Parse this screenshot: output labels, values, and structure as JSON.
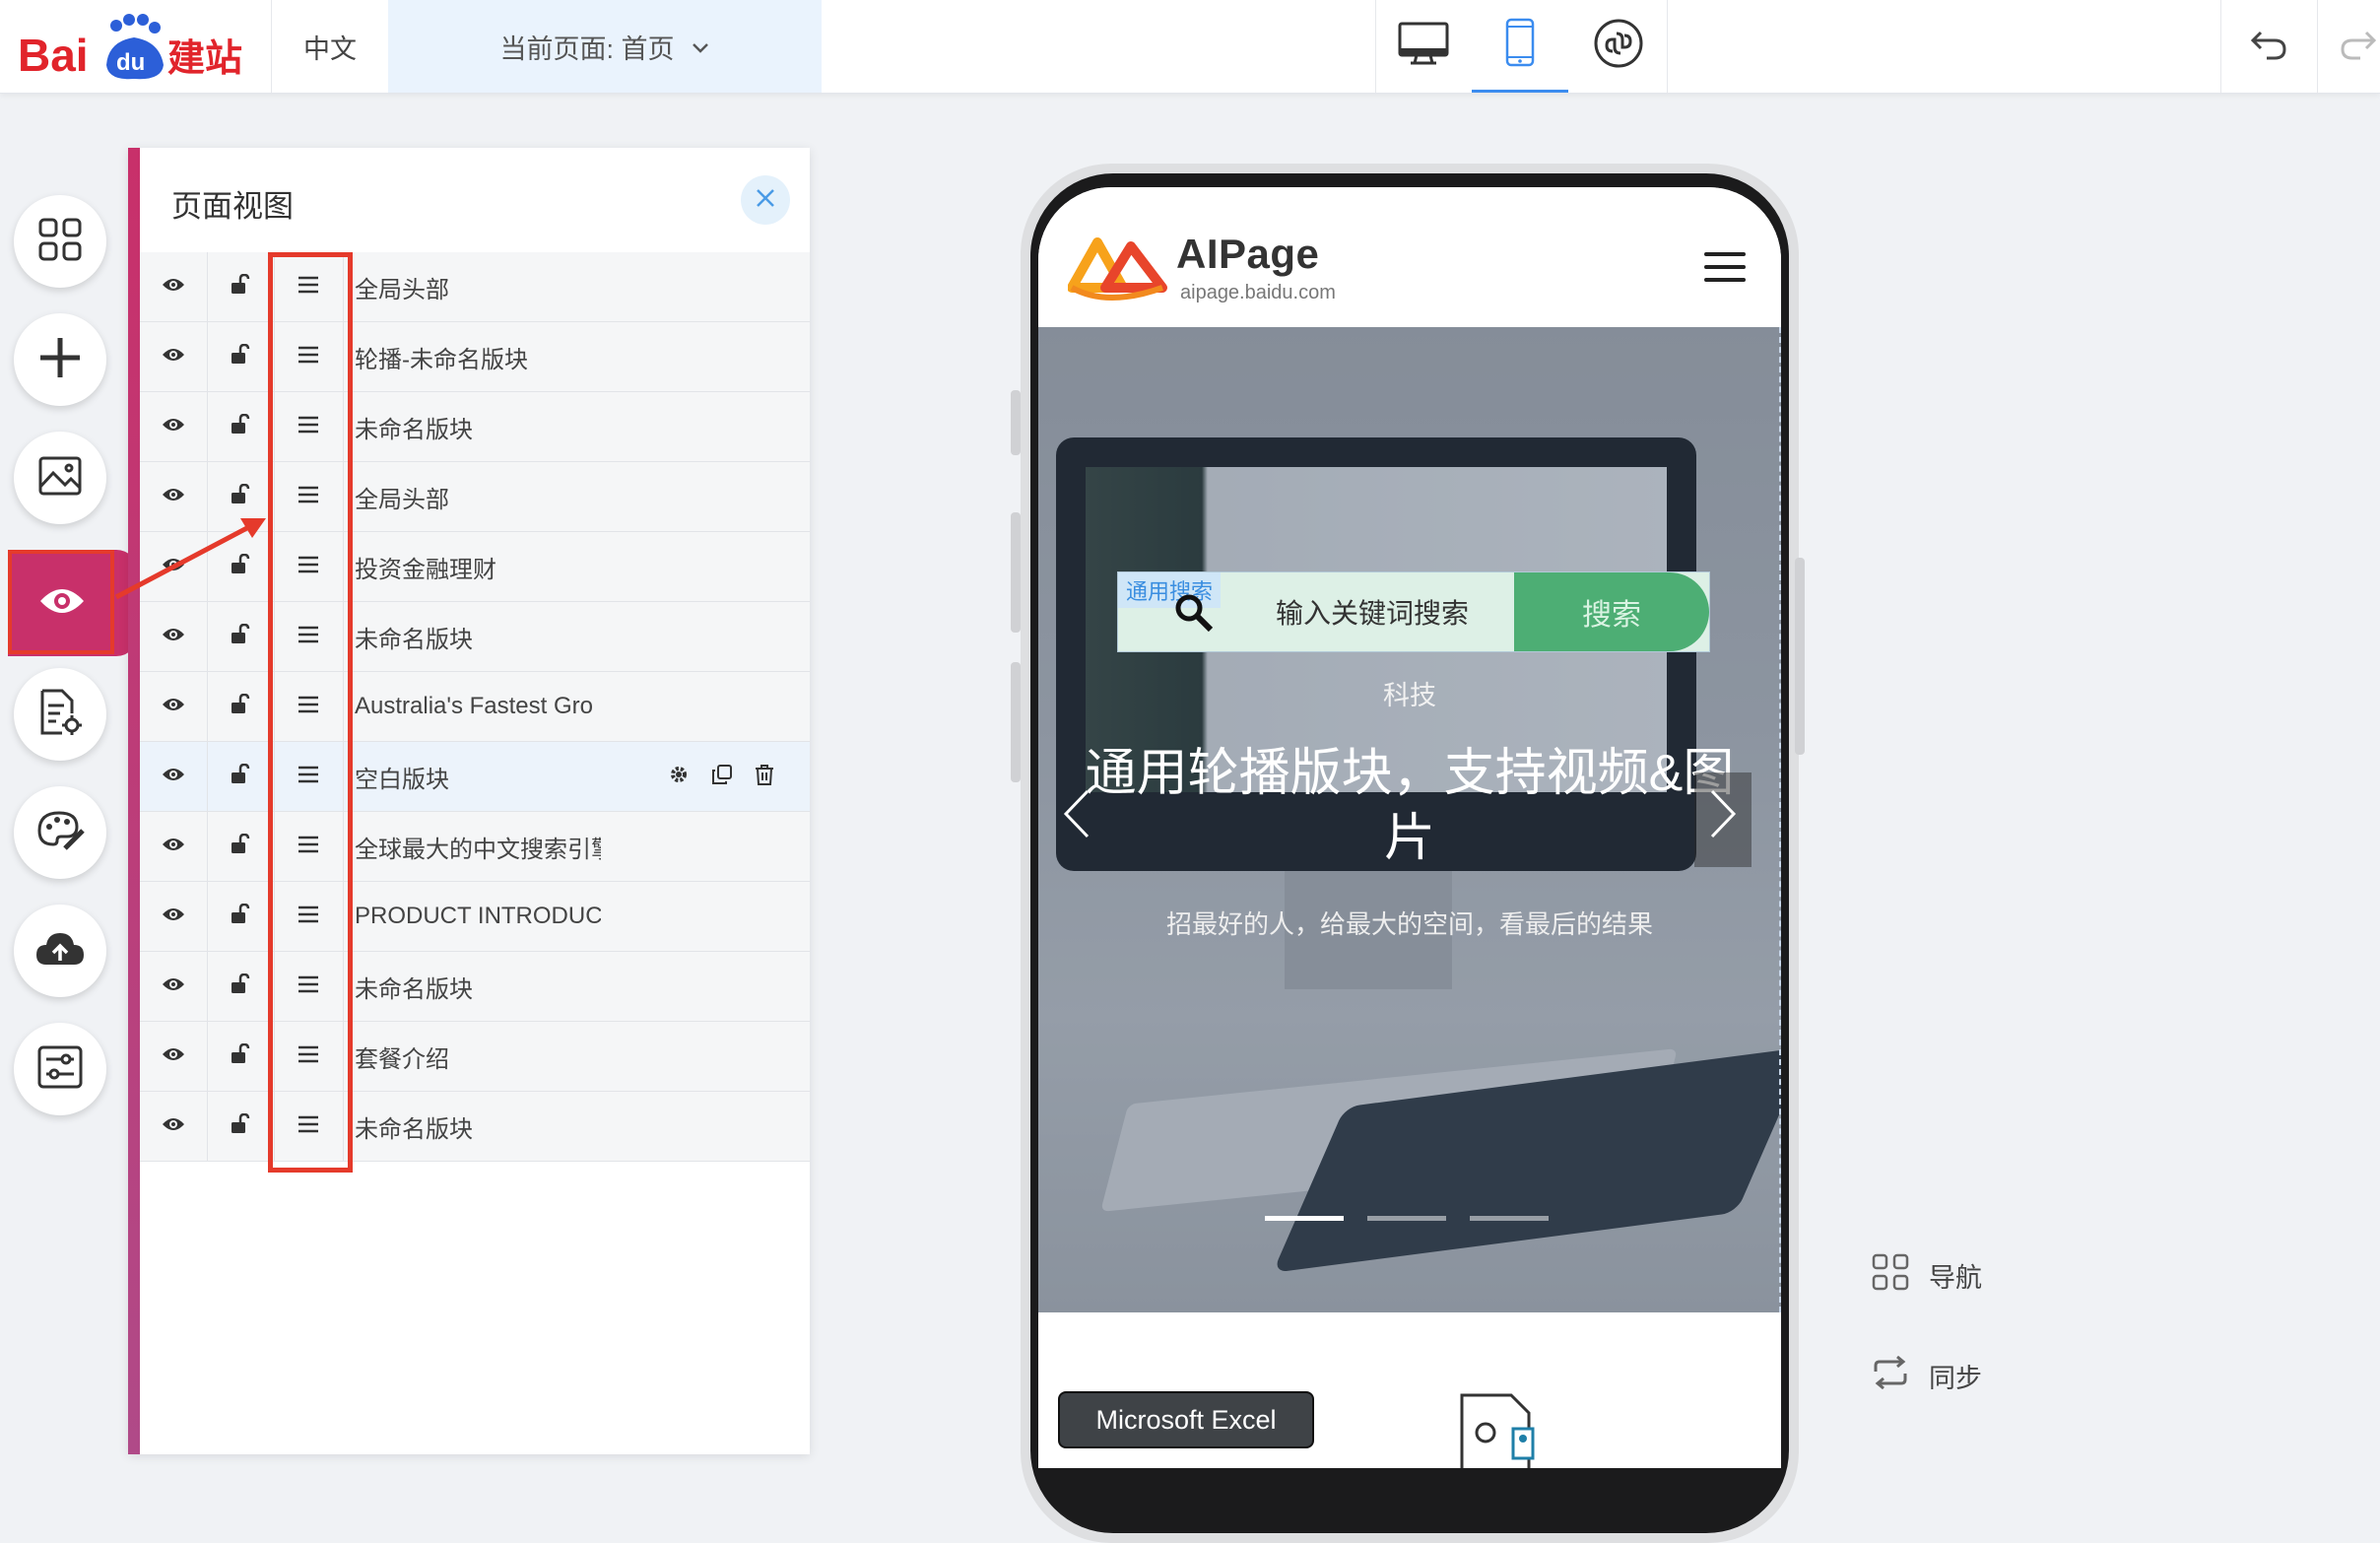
{
  "topbar": {
    "logo_text": "Baidu建站",
    "language": "中文",
    "current_page_label": "当前页面: 首页",
    "devices": [
      "desktop-icon",
      "mobile-icon",
      "mini-program-icon"
    ],
    "active_device": "mobile"
  },
  "rail": {
    "tools": [
      "grid-icon",
      "plus-icon",
      "image-icon",
      "eye-icon",
      "document-settings-icon",
      "palette-icon",
      "cloud-upload-icon",
      "sliders-icon"
    ],
    "active": "eye-icon",
    "accent_color": "#c8306a"
  },
  "panel": {
    "title": "页面视图",
    "rows": [
      {
        "name": "全局头部"
      },
      {
        "name": "轮播-未命名版块"
      },
      {
        "name": "未命名版块"
      },
      {
        "name": "全局头部"
      },
      {
        "name": "投资金融理财"
      },
      {
        "name": "未命名版块"
      },
      {
        "name": "Australia's Fastest Gro"
      },
      {
        "name": "空白版块"
      },
      {
        "name": "全球最大的中文搜索引擎"
      },
      {
        "name": "PRODUCT INTRODUCT"
      },
      {
        "name": "未命名版块"
      },
      {
        "name": "套餐介绍"
      },
      {
        "name": "未命名版块"
      }
    ],
    "highlighted_row": 7,
    "row_actions": [
      "gear-icon",
      "copy-icon",
      "trash-icon"
    ]
  },
  "preview": {
    "brand_name": "AIPage",
    "brand_url": "aipage.baidu.com",
    "search_tag": "通用搜索",
    "search_placeholder": "输入关键词搜索",
    "search_button": "搜索",
    "hero_tag": "科技",
    "hero_title": "通用轮播版块，支持视频&图片",
    "hero_subtitle": "招最好的人，给最大的空间，看最后的结果",
    "tooltip": "Microsoft Excel",
    "carousel_active_index": 0,
    "carousel_count": 3
  },
  "right_tools": {
    "nav_label": "导航",
    "sync_label": "同步"
  }
}
